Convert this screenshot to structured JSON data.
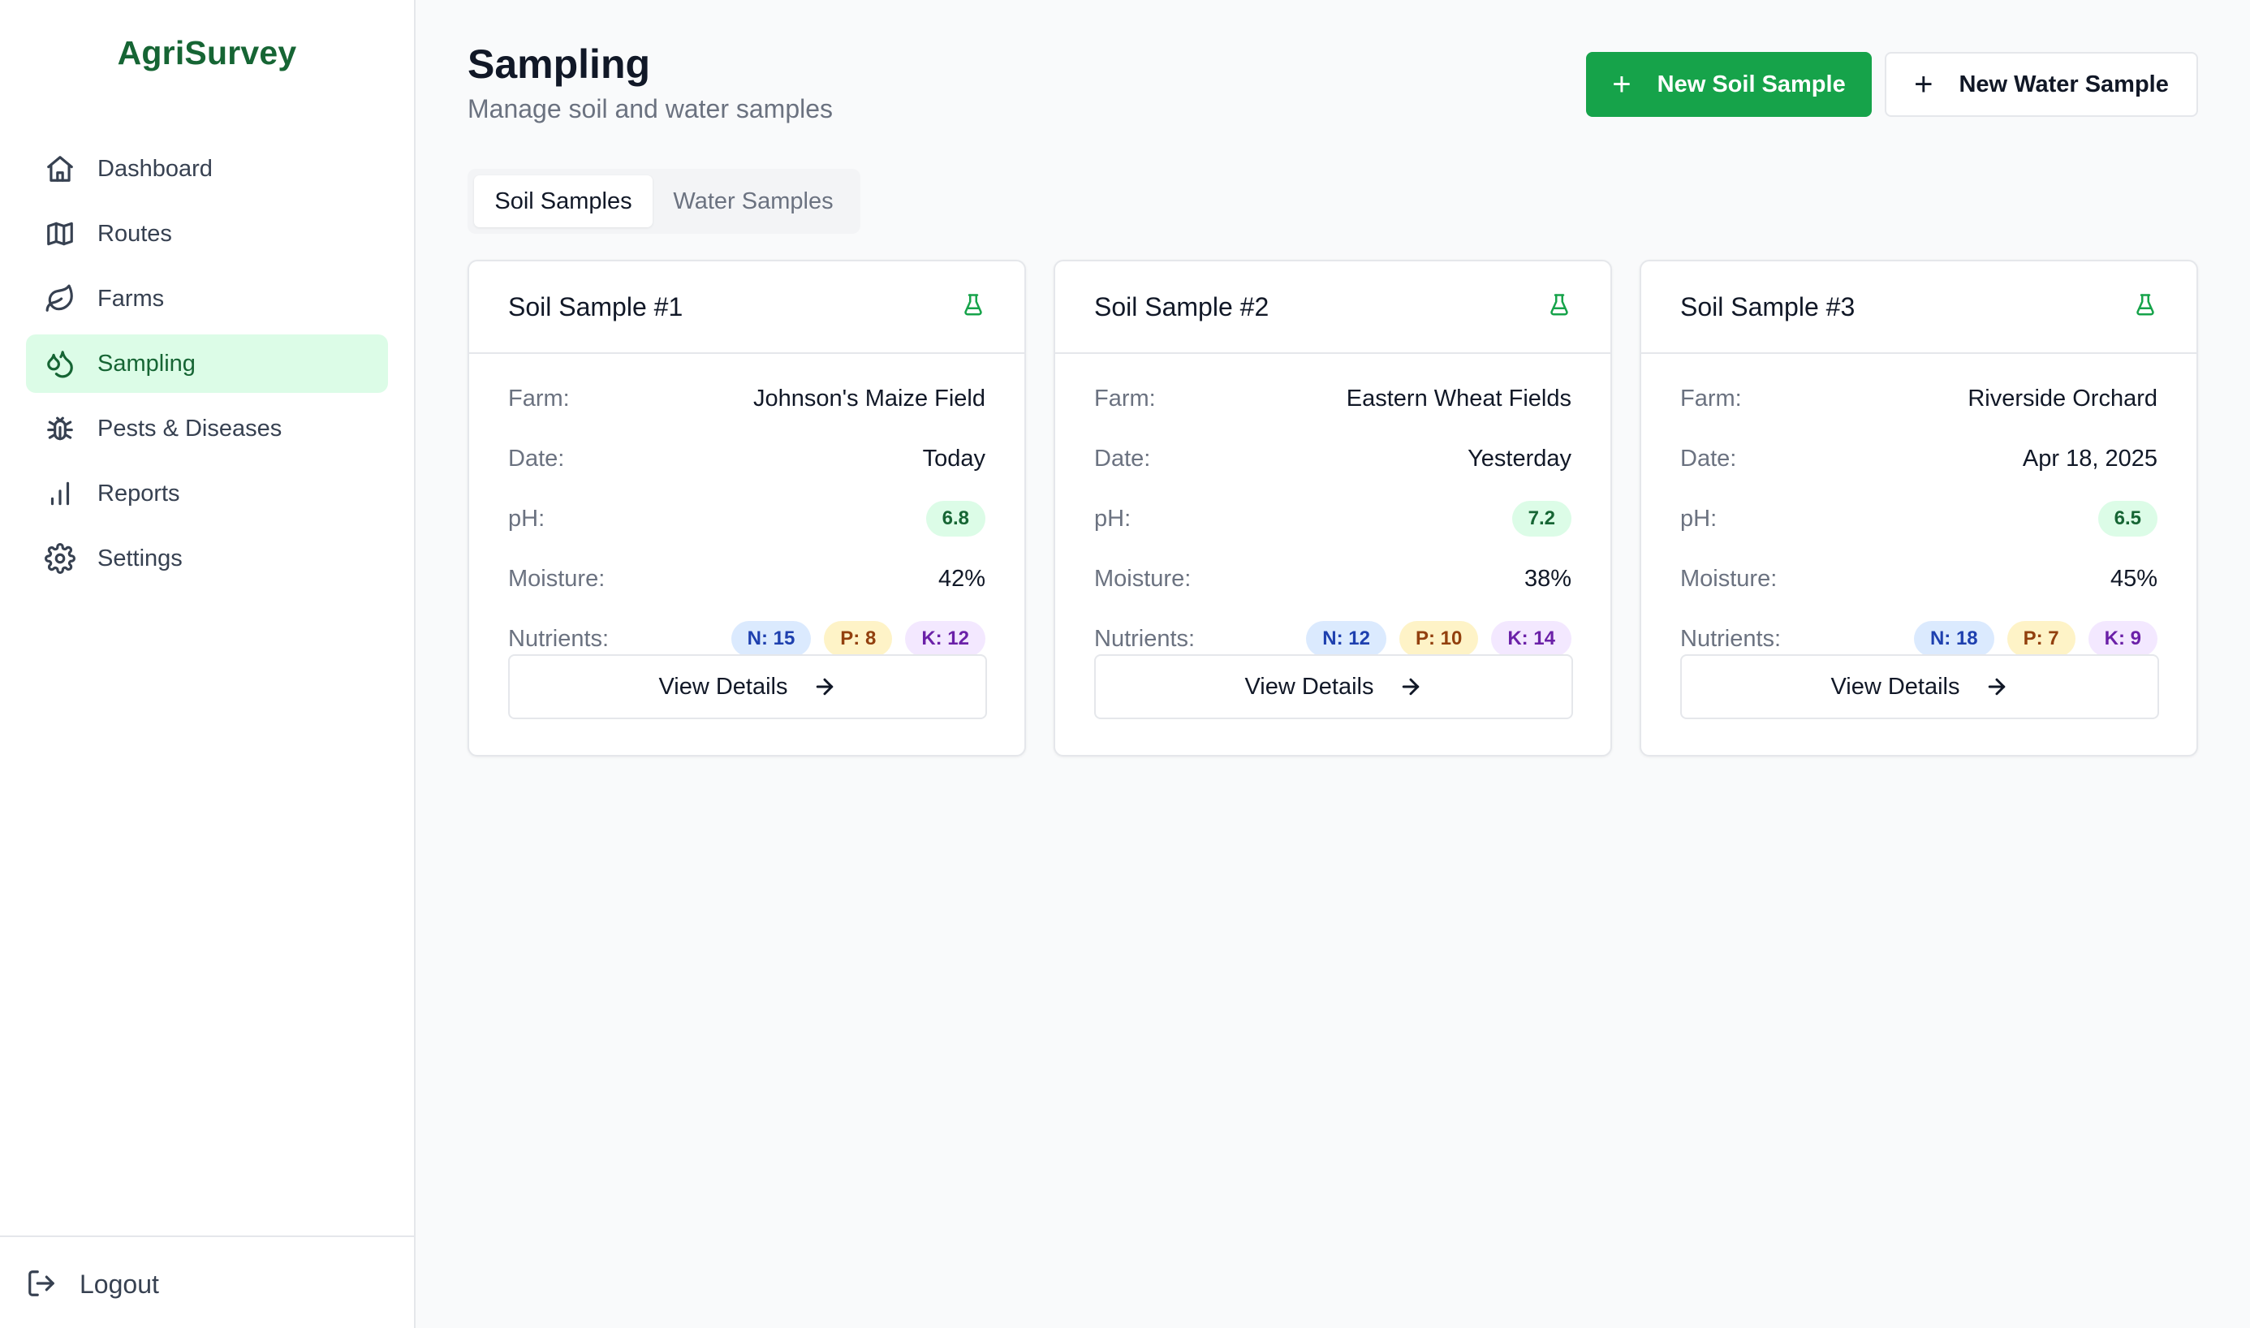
{
  "app": {
    "name": "AgriSurvey"
  },
  "sidebar": {
    "items": [
      {
        "label": "Dashboard",
        "icon": "home-icon",
        "active": false
      },
      {
        "label": "Routes",
        "icon": "map-icon",
        "active": false
      },
      {
        "label": "Farms",
        "icon": "leaf-icon",
        "active": false
      },
      {
        "label": "Sampling",
        "icon": "droplets-icon",
        "active": true
      },
      {
        "label": "Pests & Diseases",
        "icon": "bug-icon",
        "active": false
      },
      {
        "label": "Reports",
        "icon": "bar-chart-icon",
        "active": false
      },
      {
        "label": "Settings",
        "icon": "gear-icon",
        "active": false
      }
    ],
    "logout_label": "Logout"
  },
  "header": {
    "title": "Sampling",
    "subtitle": "Manage soil and water samples",
    "primary_button": "New Soil Sample",
    "secondary_button": "New Water Sample"
  },
  "tabs": [
    {
      "label": "Soil Samples",
      "active": true
    },
    {
      "label": "Water Samples",
      "active": false
    }
  ],
  "labels": {
    "farm": "Farm:",
    "date": "Date:",
    "ph": "pH:",
    "moisture": "Moisture:",
    "nutrients": "Nutrients:",
    "view_details": "View Details"
  },
  "samples": [
    {
      "title": "Soil Sample #1",
      "farm": "Johnson's Maize Field",
      "date": "Today",
      "ph": "6.8",
      "moisture": "42%",
      "n": "N: 15",
      "p": "P: 8",
      "k": "K: 12"
    },
    {
      "title": "Soil Sample #2",
      "farm": "Eastern Wheat Fields",
      "date": "Yesterday",
      "ph": "7.2",
      "moisture": "38%",
      "n": "N: 12",
      "p": "P: 10",
      "k": "K: 14"
    },
    {
      "title": "Soil Sample #3",
      "farm": "Riverside Orchard",
      "date": "Apr 18, 2025",
      "ph": "6.5",
      "moisture": "45%",
      "n": "N: 18",
      "p": "P: 7",
      "k": "K: 9"
    }
  ],
  "colors": {
    "brand": "#166534",
    "accent": "#16a34a",
    "active_nav_bg": "#dcfce7"
  }
}
